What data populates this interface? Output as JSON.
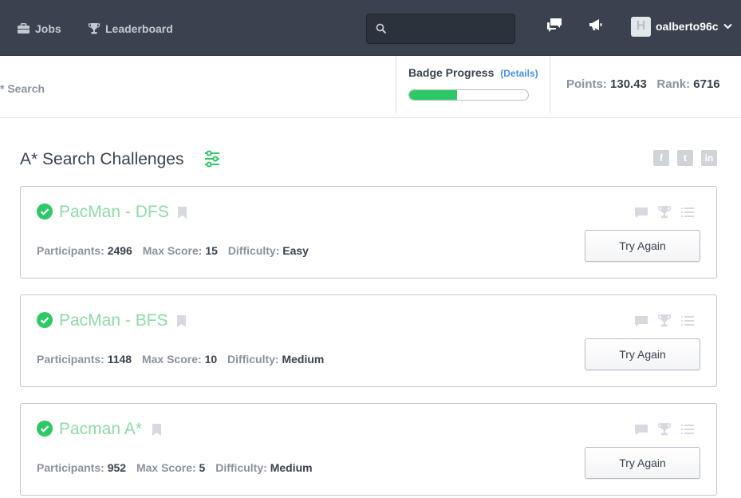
{
  "nav": {
    "jobs_label": "Jobs",
    "leaderboard_label": "Leaderboard",
    "search_placeholder": "",
    "username": "oalberto96c",
    "avatar_letter": "H"
  },
  "subheader": {
    "breadcrumb": "* Search",
    "badge_title": "Badge Progress",
    "badge_details": "(Details)",
    "badge_progress_percent": 40,
    "points_label": "Points:",
    "points_value": "130.43",
    "rank_label": "Rank:",
    "rank_value": "6716"
  },
  "main": {
    "title": "A* Search Challenges",
    "social": {
      "facebook": "f",
      "twitter": "t",
      "linkedin": "in"
    }
  },
  "labels": {
    "participants": "Participants:",
    "max_score": "Max Score:",
    "difficulty": "Difficulty:"
  },
  "challenges": [
    {
      "title": "PacMan - DFS",
      "participants": "2496",
      "max_score": "15",
      "difficulty": "Easy",
      "button": "Try Again"
    },
    {
      "title": "PacMan - BFS",
      "participants": "1148",
      "max_score": "10",
      "difficulty": "Medium",
      "button": "Try Again"
    },
    {
      "title": "Pacman A*",
      "participants": "952",
      "max_score": "5",
      "difficulty": "Medium",
      "button": "Try Again"
    }
  ],
  "colors": {
    "nav_bg": "#39424e",
    "success_green": "#2ec866",
    "title_green": "#8fd9a8",
    "link_blue": "#4a90e2"
  }
}
